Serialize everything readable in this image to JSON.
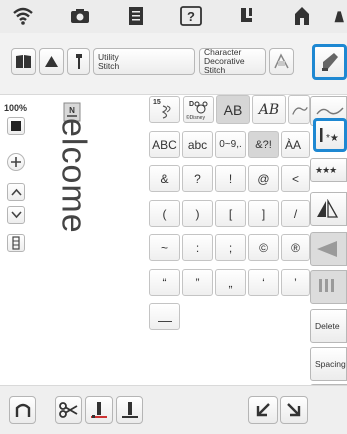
{
  "status_bar": {
    "icons": [
      "wifi-icon",
      "camera-icon",
      "document-icon",
      "help-icon",
      "thread-icon",
      "home-icon",
      "accessory-icon"
    ]
  },
  "toolbar": {
    "utility_label": "Utility\nStitch",
    "character_label": "Character\nDecorative\nStitch"
  },
  "left_panel": {
    "zoom": "100%",
    "preview_text": "elcome"
  },
  "grid": {
    "row1_font_ab": "AB",
    "row1_font_script": "AB",
    "row1_font_partial": "Ai",
    "disney_label": "©Disney",
    "number_15": "15",
    "char_tabs": [
      "ABC",
      "abc",
      "0~9,.",
      "&?!",
      "ÀA"
    ],
    "row_punct1": [
      "&",
      "?",
      "!",
      "@",
      "<"
    ],
    "row_punct2": [
      "(",
      ")",
      "[",
      "]",
      "/"
    ],
    "row_punct3": [
      "~",
      ":",
      ";",
      "©",
      "®"
    ],
    "row_punct4": [
      "“",
      "”",
      "„",
      "‘",
      "’"
    ]
  },
  "right_panel": {
    "stars_label": "★★★",
    "delete_label": "Delete",
    "spacing_label": "Spacing"
  },
  "colors": {
    "highlight": "#1e88d2",
    "background": "#ffffff"
  }
}
